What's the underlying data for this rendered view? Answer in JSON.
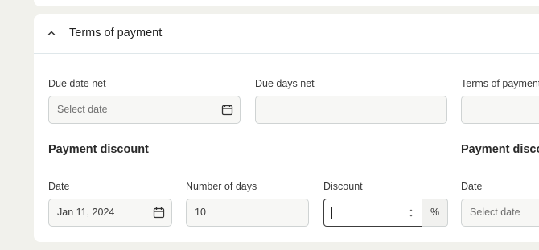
{
  "section": {
    "title": "Terms of payment"
  },
  "fields": {
    "due_date_net": {
      "label": "Due date net",
      "placeholder": "Select date"
    },
    "due_days_net": {
      "label": "Due days net",
      "value": ""
    },
    "terms_of_payment": {
      "label": "Terms of payment"
    }
  },
  "discount_left": {
    "heading": "Payment discount",
    "date": {
      "label": "Date",
      "value": "Jan 11, 2024"
    },
    "days": {
      "label": "Number of days",
      "value": "10"
    },
    "discount": {
      "label": "Discount",
      "value": "",
      "unit": "%"
    }
  },
  "discount_right": {
    "heading": "Payment disco",
    "date": {
      "label": "Date",
      "placeholder": "Select date"
    }
  },
  "icons": {
    "collapse": "chevron-up-icon",
    "calendar": "calendar-icon",
    "spinner": "stepper-arrows-icon"
  },
  "colors": {
    "background": "#f1f1ec",
    "card": "#ffffff",
    "field_bg": "#f7f7f5",
    "field_border": "#cfd3d3",
    "focused_border": "#3c3c3c"
  }
}
